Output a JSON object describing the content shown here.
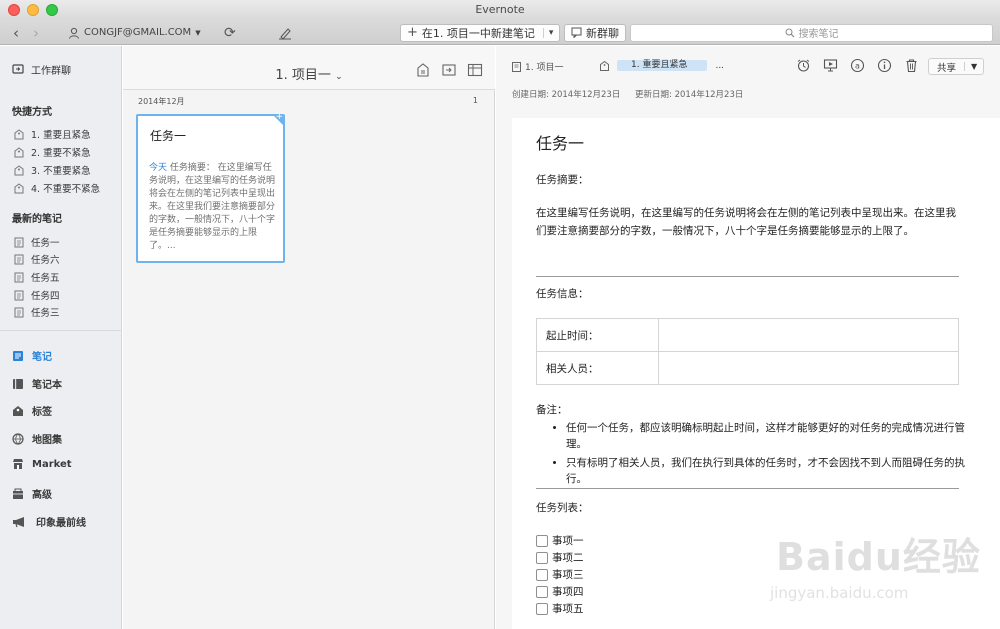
{
  "window": {
    "title": "Evernote"
  },
  "toolbar": {
    "account": "CONGJF@GMAIL.COM",
    "new_note_label": "在1. 项目一中新建笔记",
    "new_chat_label": "新群聊",
    "search_placeholder": "搜索笔记"
  },
  "sidebar": {
    "work_chat": "工作群聊",
    "shortcuts_heading": "快捷方式",
    "shortcuts": [
      "1. 重要且紧急",
      "2. 重要不紧急",
      "3. 不重要紧急",
      "4. 不重要不紧急"
    ],
    "recent_heading": "最新的笔记",
    "recent": [
      "任务一",
      "任务六",
      "任务五",
      "任务四",
      "任务三"
    ],
    "nav": [
      "笔记",
      "笔记本",
      "标签",
      "地图集",
      "Market",
      "高级",
      "印象最前线"
    ]
  },
  "note_list": {
    "title": "1. 项目一",
    "date_group": "2014年12月",
    "count": "1",
    "card": {
      "title": "任务一",
      "date_label": "今天",
      "snippet": "任务摘要：  在这里编写任务说明，在这里编写的任务说明将会在左侧的笔记列表中呈现出来。在这里我们要注意摘要部分的字数，一般情况下，八十个字是任务摘要能够显示的上限了。..."
    }
  },
  "editor": {
    "notebook": "1. 项目一",
    "tag": "1. 重要且紧急",
    "more": "...",
    "share_label": "共享",
    "created": "创建日期: 2014年12月23日",
    "updated": "更新日期: 2014年12月23日",
    "doc_title": "任务一",
    "summary_label": "任务摘要：",
    "summary_text": "在这里编写任务说明，在这里编写的任务说明将会在左侧的笔记列表中呈现出来。在这里我们要注意摘要部分的字数，一般情况下，八十个字是任务摘要能够显示的上限了。",
    "info_label": "任务信息：",
    "info_rows": [
      {
        "key": "起止时间：",
        "value": ""
      },
      {
        "key": "相关人员：",
        "value": ""
      }
    ],
    "remarks_label": "备注：",
    "remarks": [
      "任何一个任务，都应该明确标明起止时间，这样才能够更好的对任务的完成情况进行管理。",
      "只有标明了相关人员，我们在执行到具体的任务时，才不会因找不到人而阻碍任务的执行。"
    ],
    "tasklist_label": "任务列表：",
    "tasks": [
      "事项一",
      "事项二",
      "事项三",
      "事项四",
      "事项五"
    ]
  },
  "watermark": {
    "brand": "Baidu经验",
    "url": "jingyan.baidu.com"
  },
  "colors": {
    "accent": "#2b83d8",
    "card_border": "#6fb3ec",
    "tag_pill": "#cfe3f6"
  }
}
